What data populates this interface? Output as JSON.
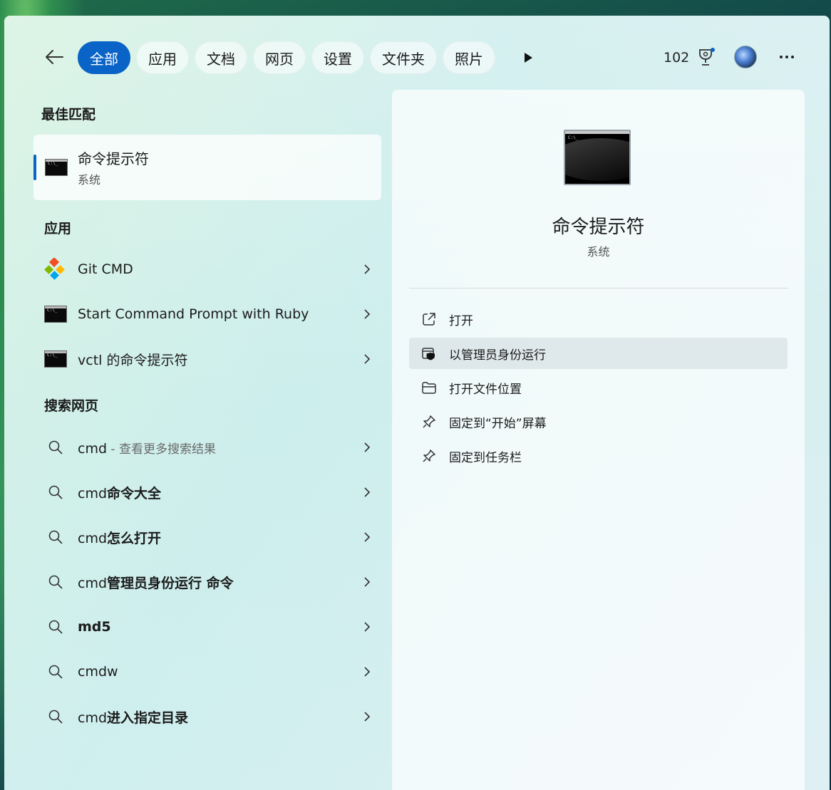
{
  "topbar": {
    "tabs": [
      "全部",
      "应用",
      "文档",
      "网页",
      "设置",
      "文件夹",
      "照片"
    ],
    "points": "102"
  },
  "best_match": {
    "heading": "最佳匹配",
    "title": "命令提示符",
    "subtitle": "系统"
  },
  "apps": {
    "heading": "应用",
    "items": [
      "Git CMD",
      "Start Command Prompt with Ruby",
      "vctl 的命令提示符"
    ]
  },
  "web": {
    "heading": "搜索网页",
    "items": [
      {
        "prefix": "cmd",
        "bold": "",
        "suffix": " - 查看更多搜索结果"
      },
      {
        "prefix": "cmd",
        "bold": "命令大全",
        "suffix": ""
      },
      {
        "prefix": "cmd",
        "bold": "怎么打开",
        "suffix": ""
      },
      {
        "prefix": "cmd",
        "bold": "管理员身份运行 命令",
        "suffix": ""
      },
      {
        "prefix": "",
        "bold": "md5",
        "suffix": ""
      },
      {
        "prefix": "cmdw",
        "bold": "",
        "suffix": ""
      },
      {
        "prefix": "cmd",
        "bold": "进入指定目录",
        "suffix": ""
      }
    ]
  },
  "detail": {
    "name": "命令提示符",
    "type": "系统",
    "actions": [
      "打开",
      "以管理员身份运行",
      "打开文件位置",
      "固定到“开始”屏幕",
      "固定到任务栏"
    ]
  },
  "colors": {
    "accent": "#0a63c6"
  }
}
